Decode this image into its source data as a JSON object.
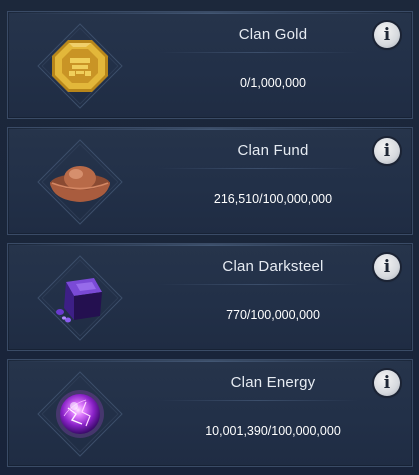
{
  "resources": [
    {
      "id": "gold",
      "title": "Clan Gold",
      "value": "0/1,000,000",
      "icon": "clan-gold-coin-icon"
    },
    {
      "id": "fund",
      "title": "Clan Fund",
      "value": "216,510/100,000,000",
      "icon": "clan-fund-ingot-icon"
    },
    {
      "id": "darksteel",
      "title": "Clan Darksteel",
      "value": "770/100,000,000",
      "icon": "clan-darksteel-cube-icon"
    },
    {
      "id": "energy",
      "title": "Clan Energy",
      "value": "10,001,390/100,000,000",
      "icon": "clan-energy-orb-icon"
    }
  ],
  "info_glyph": "i",
  "colors": {
    "panel": "#223048",
    "border": "#3a4b66",
    "text": "#e6ebf2",
    "gold": "#d9a928",
    "fund": "#a75a3c",
    "darksteel": "#5a2fb0",
    "energy": "#b24be0"
  }
}
